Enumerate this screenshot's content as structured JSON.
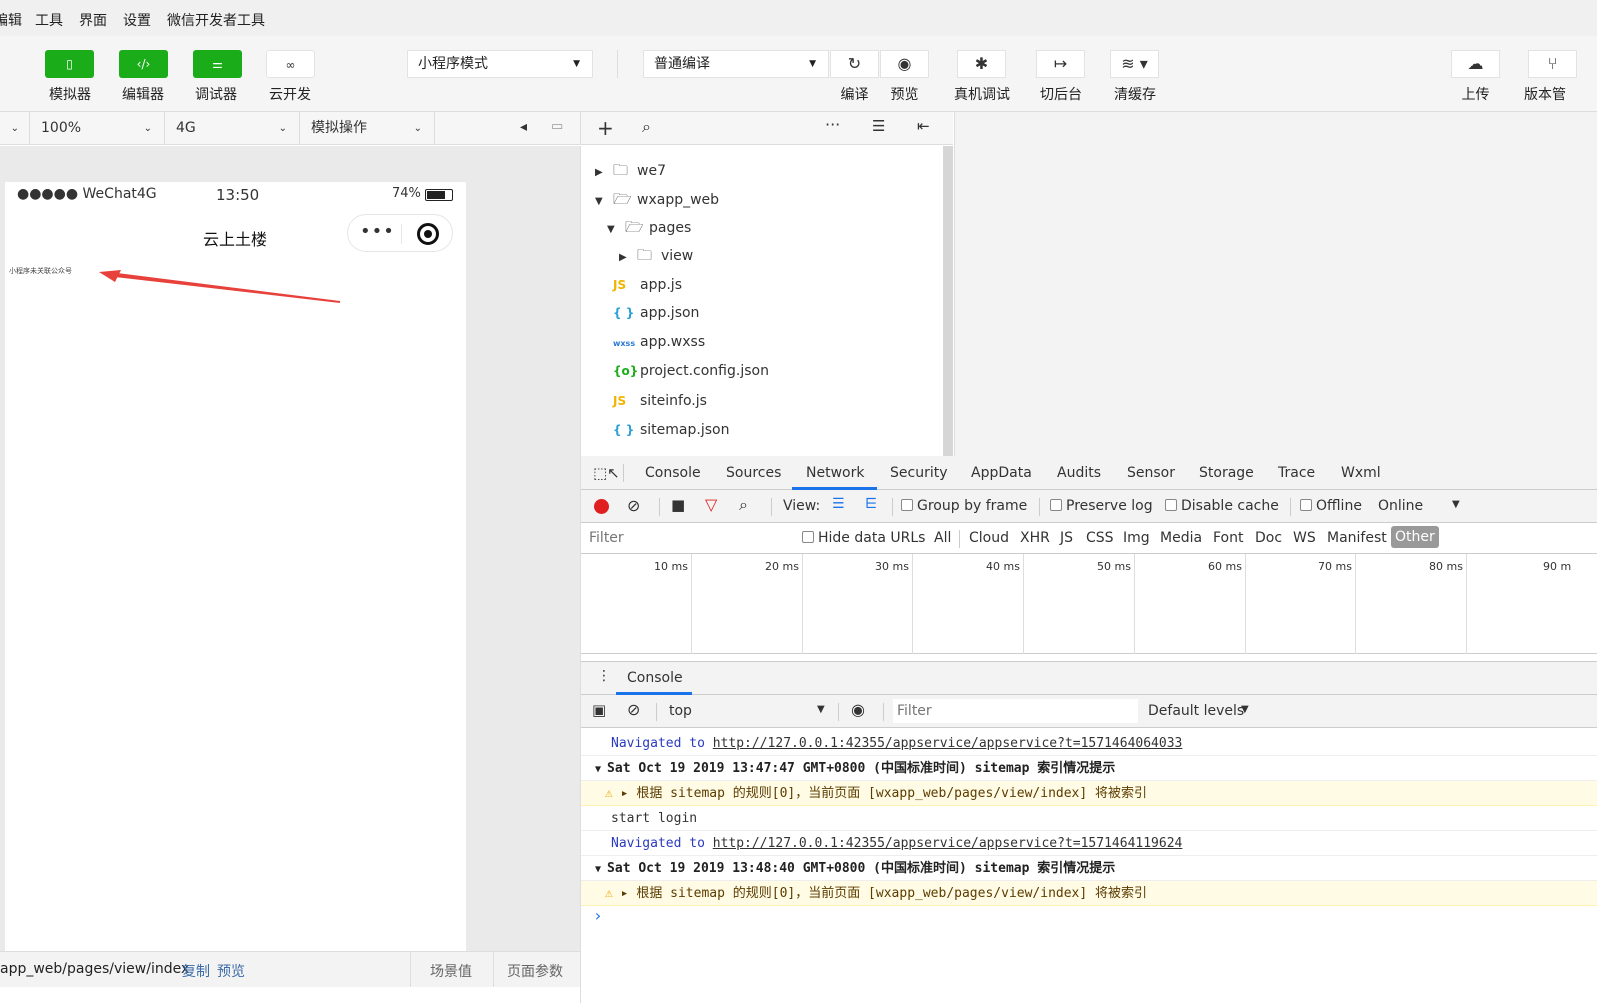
{
  "menu": [
    "编辑",
    "工具",
    "界面",
    "设置",
    "微信开发者工具"
  ],
  "toolbar": {
    "buttons": [
      {
        "label": "模拟器",
        "icon": "phone-icon"
      },
      {
        "label": "编辑器",
        "icon": "code-icon"
      },
      {
        "label": "调试器",
        "icon": "debug-sliders-icon"
      },
      {
        "label": "云开发",
        "icon": "cloud-link-icon"
      }
    ],
    "mode_select": "小程序模式",
    "compile_select": "普通编译",
    "actions": [
      {
        "label": "编译",
        "icon": "refresh-icon"
      },
      {
        "label": "预览",
        "icon": "eye-icon"
      },
      {
        "label": "真机调试",
        "icon": "bug-icon"
      },
      {
        "label": "切后台",
        "icon": "switch-icon"
      },
      {
        "label": "清缓存",
        "icon": "layers-icon"
      }
    ],
    "right_actions": [
      {
        "label": "上传",
        "icon": "upload-cloud-icon"
      },
      {
        "label": "版本管",
        "icon": "branch-icon"
      }
    ]
  },
  "simbar": {
    "zoom": "100%",
    "network": "4G",
    "operation": "模拟操作"
  },
  "phone": {
    "carrier": "●●●●● WeChat4G",
    "time": "13:50",
    "battery": "74%",
    "battery_level": 0.74,
    "title": "云上土楼",
    "content_text": "小程序未关联公众号"
  },
  "statusbar": {
    "path": "app_web/pages/view/index",
    "copy": "复制",
    "preview": "预览",
    "scene": "场景值",
    "params": "页面参数"
  },
  "filetree": [
    {
      "name": "we7",
      "type": "folder-closed",
      "indent": 0
    },
    {
      "name": "wxapp_web",
      "type": "folder-open",
      "indent": 0
    },
    {
      "name": "pages",
      "type": "folder-open",
      "indent": 1
    },
    {
      "name": "view",
      "type": "folder-closed",
      "indent": 2
    },
    {
      "name": "app.js",
      "type": "js",
      "indent": 1
    },
    {
      "name": "app.json",
      "type": "json",
      "indent": 1
    },
    {
      "name": "app.wxss",
      "type": "wxss",
      "indent": 1
    },
    {
      "name": "project.config.json",
      "type": "config",
      "indent": 1
    },
    {
      "name": "siteinfo.js",
      "type": "js",
      "indent": 1
    },
    {
      "name": "sitemap.json",
      "type": "json",
      "indent": 1
    }
  ],
  "icon_labels": {
    "js": "JS",
    "json": "{ }",
    "wxss": "wxss",
    "config": "{o}"
  },
  "devtools": {
    "tabs": [
      "Console",
      "Sources",
      "Network",
      "Security",
      "AppData",
      "Audits",
      "Sensor",
      "Storage",
      "Trace",
      "Wxml"
    ],
    "active_tab": "Network",
    "view_label": "View:",
    "options": [
      "Group by frame",
      "Preserve log",
      "Disable cache",
      "Offline"
    ],
    "online": "Online",
    "filter_placeholder": "Filter",
    "hide_data_urls": "Hide data URLs",
    "types": [
      "All",
      "Cloud",
      "XHR",
      "JS",
      "CSS",
      "Img",
      "Media",
      "Font",
      "Doc",
      "WS",
      "Manifest",
      "Other"
    ],
    "ticks": [
      "10 ms",
      "20 ms",
      "30 ms",
      "40 ms",
      "50 ms",
      "60 ms",
      "70 ms",
      "80 ms",
      "90 m"
    ],
    "drawer_tab": "Console",
    "context": "top",
    "console_filter": "Filter",
    "levels": "Default levels",
    "logs": [
      {
        "kind": "nav",
        "prefix": "Navigated to",
        "url": "http://127.0.0.1:42355/appservice/appservice?t=1571464064033"
      },
      {
        "kind": "group",
        "text": "Sat Oct 19 2019 13:47:47 GMT+0800 (中国标准时间) sitemap 索引情况提示"
      },
      {
        "kind": "warn",
        "text": "根据 sitemap 的规则[0]，当前页面 [wxapp_web/pages/view/index] 将被索引"
      },
      {
        "kind": "plain",
        "text": "start login"
      },
      {
        "kind": "nav",
        "prefix": "Navigated to",
        "url": "http://127.0.0.1:42355/appservice/appservice?t=1571464119624"
      },
      {
        "kind": "group",
        "text": "Sat Oct 19 2019 13:48:40 GMT+0800 (中国标准时间) sitemap 索引情况提示"
      },
      {
        "kind": "warn",
        "text": "根据 sitemap 的规则[0]，当前页面 [wxapp_web/pages/view/index] 将被索引"
      }
    ],
    "prompt": "›"
  },
  "colors": {
    "green": "#1aad19",
    "red": "#e02020",
    "blue": "#1a73e8",
    "annotation_arrow": "#e8403a"
  }
}
